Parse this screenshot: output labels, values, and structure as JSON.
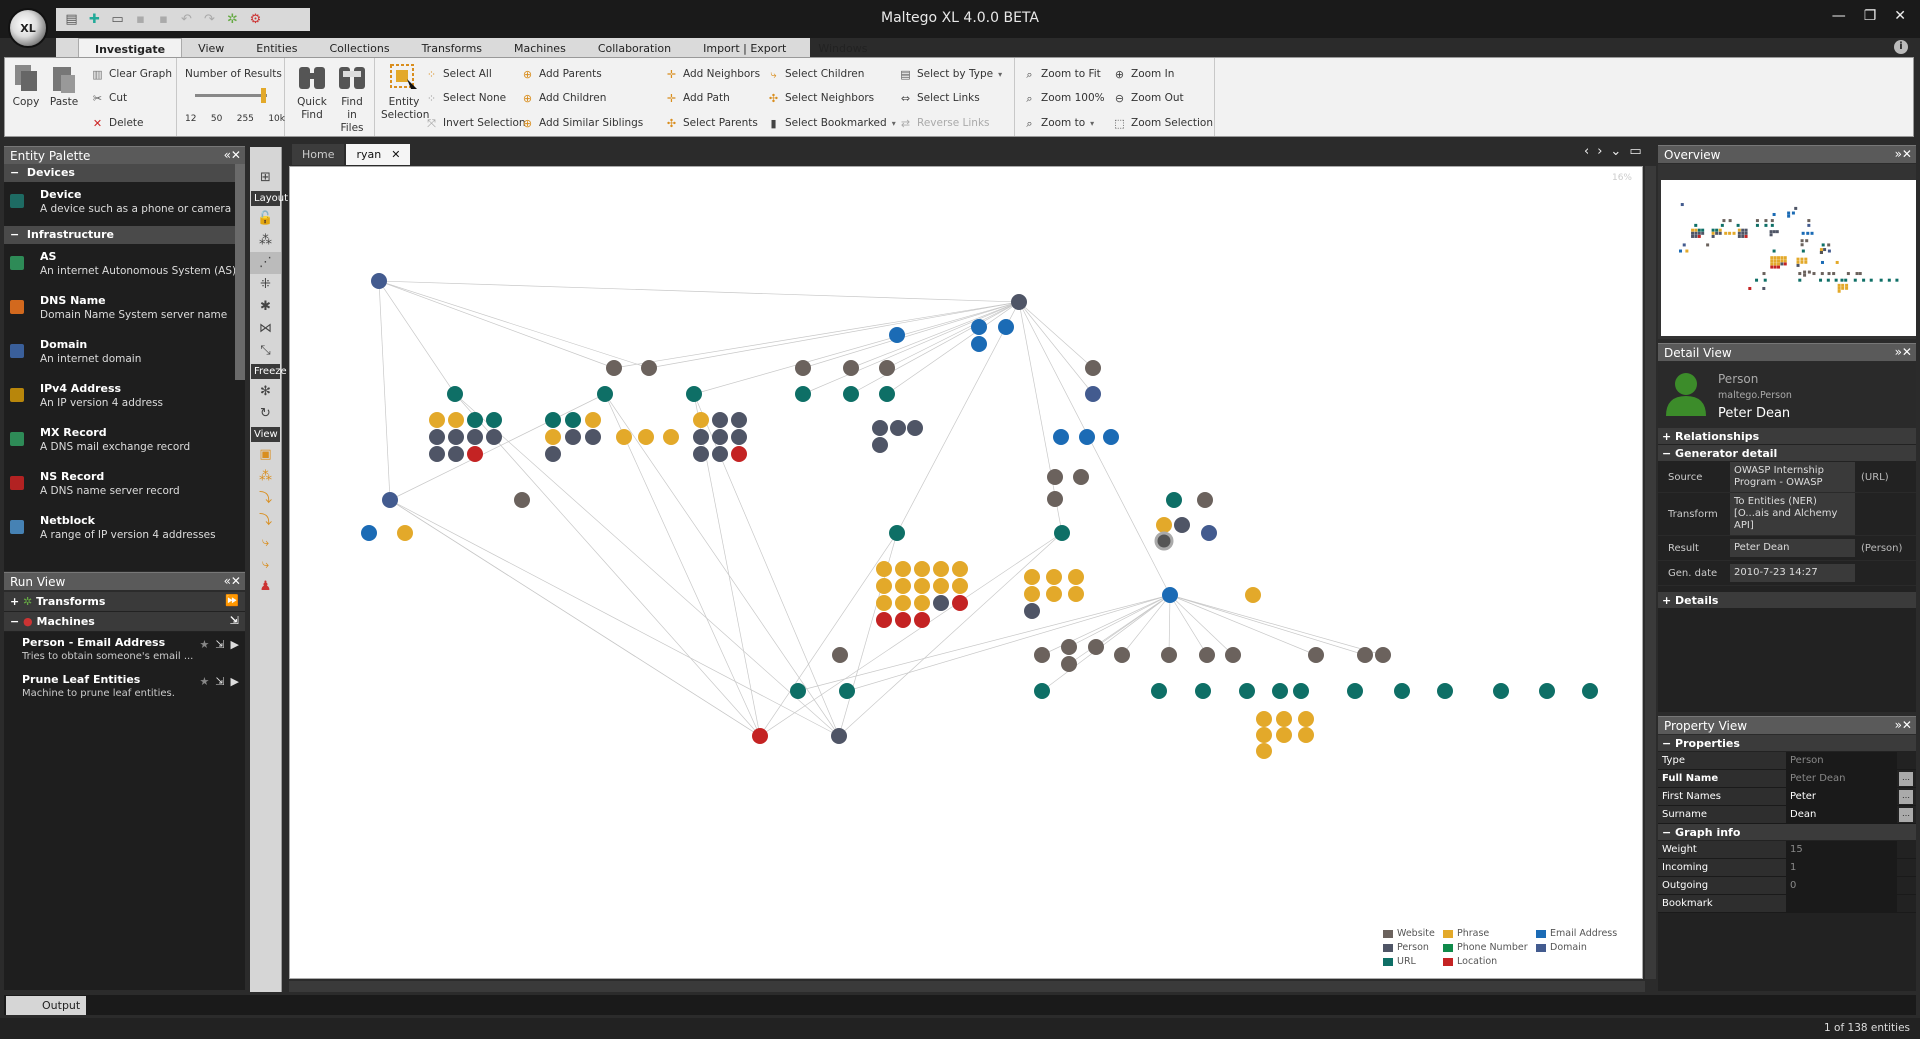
{
  "app": {
    "title": "Maltego XL 4.0.0 BETA",
    "logo_text": "XL",
    "win_controls": [
      "—",
      "❐",
      "✕"
    ]
  },
  "menu_tabs": [
    "Investigate",
    "View",
    "Entities",
    "Collections",
    "Transforms",
    "Machines",
    "Collaboration",
    "Import | Export",
    "Windows"
  ],
  "ribbon": {
    "copy": "Copy",
    "paste": "Paste",
    "clear_graph": "Clear Graph",
    "cut": "Cut",
    "delete": "Delete",
    "number_of_results": "Number of Results",
    "result_ticks": [
      "12",
      "50",
      "255",
      "10k"
    ],
    "quick_find": "Quick Find",
    "find_in_files": "Find in Files",
    "entity_selection": "Entity Selection",
    "select_all": "Select All",
    "select_none": "Select None",
    "invert_selection": "Invert Selection",
    "add_parents": "Add Parents",
    "add_children": "Add Children",
    "add_similar_siblings": "Add Similar Siblings",
    "add_neighbors": "Add Neighbors",
    "add_path": "Add Path",
    "select_parents": "Select Parents",
    "select_children": "Select Children",
    "select_neighbors": "Select Neighbors",
    "select_bookmarked": "Select Bookmarked",
    "select_by_type": "Select by Type",
    "select_links": "Select Links",
    "reverse_links": "Reverse Links",
    "zoom_to_fit": "Zoom to Fit",
    "zoom_100": "Zoom 100%",
    "zoom_to": "Zoom to",
    "zoom_in": "Zoom In",
    "zoom_out": "Zoom Out",
    "zoom_selection": "Zoom Selection"
  },
  "entity_palette": {
    "title": "Entity Palette",
    "categories": [
      {
        "name": "Devices",
        "items": [
          {
            "name": "Device",
            "desc": "A device such as a phone or camera",
            "color": "#1e6b63"
          }
        ]
      },
      {
        "name": "Infrastructure",
        "items": [
          {
            "name": "AS",
            "desc": "An internet Autonomous System (AS)",
            "color": "#2e8b57"
          },
          {
            "name": "DNS Name",
            "desc": "Domain Name System server name",
            "color": "#d2691e"
          },
          {
            "name": "Domain",
            "desc": "An internet domain",
            "color": "#3a5f9a"
          },
          {
            "name": "IPv4 Address",
            "desc": "An IP version 4 address",
            "color": "#b8860b"
          },
          {
            "name": "MX Record",
            "desc": "A DNS mail exchange record",
            "color": "#2e8b57"
          },
          {
            "name": "NS Record",
            "desc": "A DNS name server record",
            "color": "#b22222"
          },
          {
            "name": "Netblock",
            "desc": "A range of IP version 4 addresses",
            "color": "#4682b4"
          }
        ]
      }
    ]
  },
  "run_view": {
    "title": "Run View",
    "transforms": "Transforms",
    "machines": "Machines",
    "machine_items": [
      {
        "name": "Person - Email Address",
        "desc": "Tries to obtain someone's email ..."
      },
      {
        "name": "Prune Leaf Entities",
        "desc": "Machine to prune leaf entities."
      }
    ]
  },
  "layout_bar": {
    "layout": "Layout",
    "freeze": "Freeze",
    "view": "View"
  },
  "graph_tabs": [
    "Home",
    "ryan"
  ],
  "graph": {
    "zoom_pct": "16%"
  },
  "legend": [
    {
      "label": "Website",
      "color": "#6b625d"
    },
    {
      "label": "Phrase",
      "color": "#e3a92a"
    },
    {
      "label": "Email Address",
      "color": "#1b6bb5"
    },
    {
      "label": "Person",
      "color": "#4f5566"
    },
    {
      "label": "Phone Number",
      "color": "#0f8a4a"
    },
    {
      "label": "Domain",
      "color": "#435b8f"
    },
    {
      "label": "URL",
      "color": "#0e6f66"
    },
    {
      "label": "Location",
      "color": "#c42323"
    }
  ],
  "overview": {
    "title": "Overview"
  },
  "detail_view": {
    "title": "Detail View",
    "entity_type": "Person",
    "entity_type_id": "maltego.Person",
    "entity_name": "Peter Dean",
    "relationships": "+ Relationships",
    "generator_detail": "− Generator detail",
    "rows": [
      {
        "k": "Source",
        "v": "OWASP Internship Program - OWASP",
        "t": "(URL)"
      },
      {
        "k": "Transform",
        "v": "To Entities (NER) [O...ais and Alchemy API]",
        "t": ""
      },
      {
        "k": "Result",
        "v": "Peter Dean",
        "t": "(Person)"
      },
      {
        "k": "Gen. date",
        "v": "2010-7-23 14:27",
        "t": ""
      }
    ],
    "details": "+ Details"
  },
  "property_view": {
    "title": "Property View",
    "properties": "− Properties",
    "rows": [
      {
        "k": "Type",
        "v": "Person",
        "dim": true
      },
      {
        "k": "Full Name",
        "v": "Peter Dean",
        "dim": true,
        "bold": true
      },
      {
        "k": "First Names",
        "v": "Peter",
        "dim": false
      },
      {
        "k": "Surname",
        "v": "Dean",
        "dim": false
      }
    ],
    "graph_info": "− Graph info",
    "info_rows": [
      {
        "k": "Weight",
        "v": "15"
      },
      {
        "k": "Incoming",
        "v": "1"
      },
      {
        "k": "Outgoing",
        "v": "0"
      },
      {
        "k": "Bookmark",
        "v": ""
      }
    ]
  },
  "output_tab": "Output",
  "status": "1 of 138 entities"
}
